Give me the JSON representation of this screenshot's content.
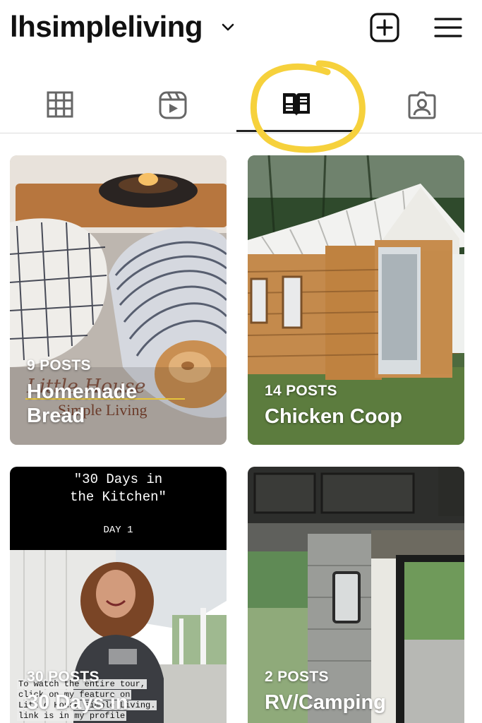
{
  "header": {
    "username": "lhsimpleliving",
    "icons": {
      "chevron": "chevron-down-icon",
      "add": "plus-square-icon",
      "menu": "hamburger-menu-icon"
    }
  },
  "tabs": [
    {
      "icon": "grid-icon",
      "selected": false
    },
    {
      "icon": "reels-icon",
      "selected": false
    },
    {
      "icon": "guides-book-icon",
      "selected": true
    },
    {
      "icon": "tagged-person-icon",
      "selected": false
    }
  ],
  "colors": {
    "highlight": "#f6d13c",
    "underline": "#222222"
  },
  "guides": [
    {
      "count": "9 POSTS",
      "title": "Homemade Bread",
      "watermark": {
        "line1": "Little House",
        "line2": "Simple Living"
      }
    },
    {
      "count": "14 POSTS",
      "title": "Chicken Coop"
    },
    {
      "count": "30 POSTS",
      "title": "30 Days in",
      "overlay_title": "\"30 Days in\nthe Kitchen\"",
      "overlay_day": "DAY 1",
      "caption": [
        "To watch the entire tour,",
        "click on my feature on",
        "Little House Simple Living.",
        "link is in my profile"
      ]
    },
    {
      "count": "2 POSTS",
      "title": "RV/Camping"
    }
  ]
}
